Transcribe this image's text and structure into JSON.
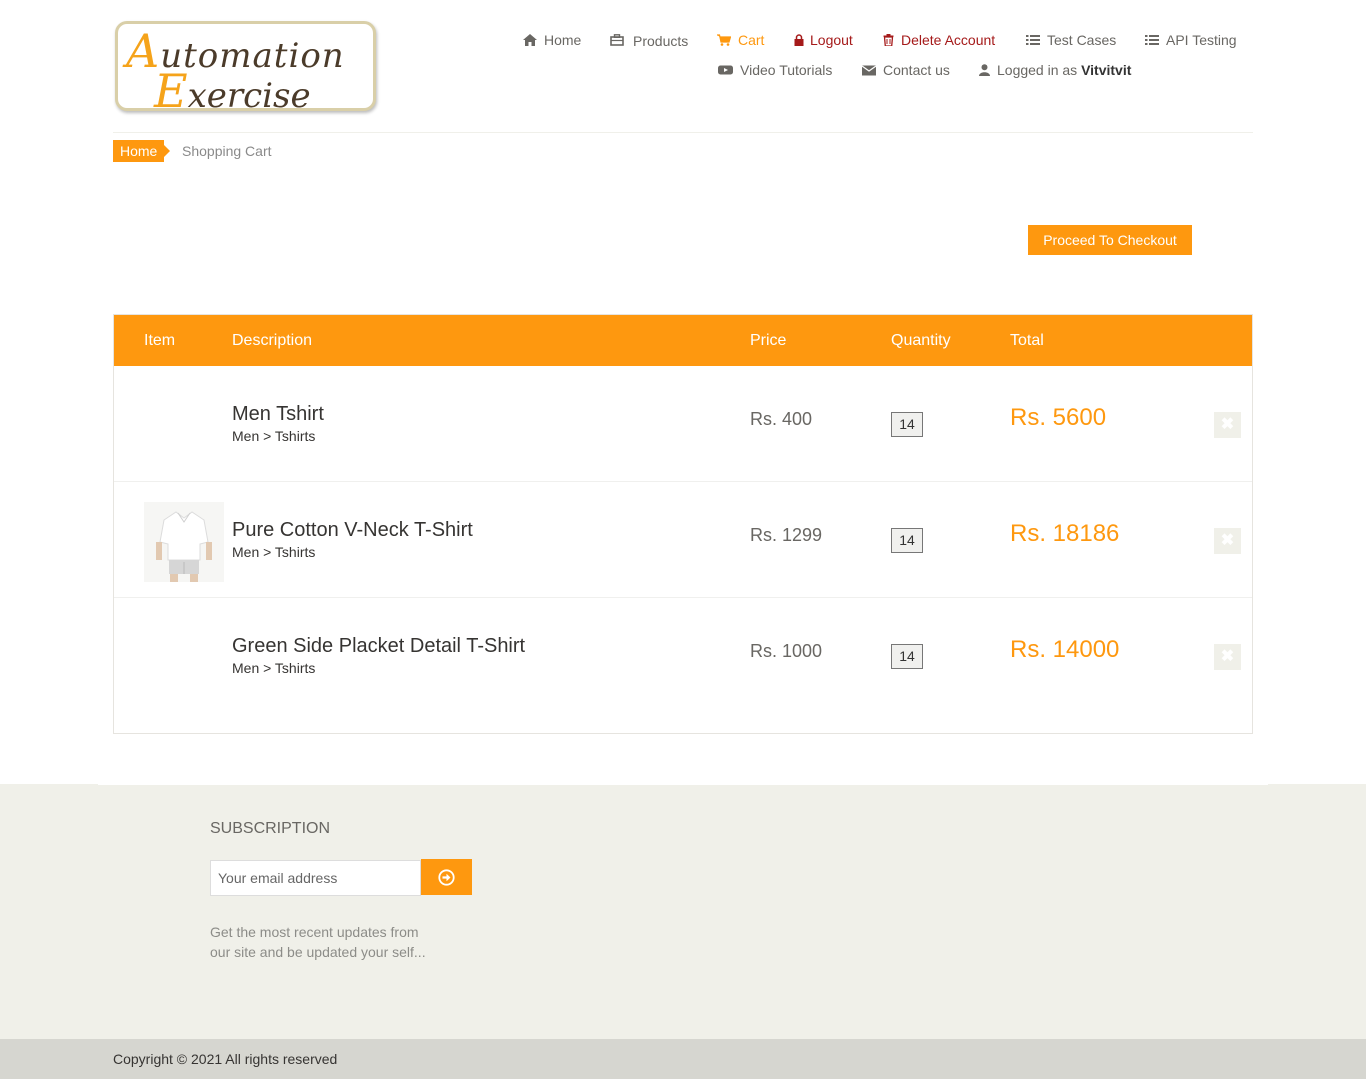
{
  "logo": {
    "line1_big": "A",
    "line1_rest": "utomation",
    "line2_big": "E",
    "line2_rest": "xercise"
  },
  "nav": {
    "home": "Home",
    "products": "Products",
    "cart": "Cart",
    "logout": "Logout",
    "delete_account": "Delete Account",
    "test_cases": "Test Cases",
    "api_testing": "API Testing",
    "video_tutorials": "Video Tutorials",
    "contact_us": "Contact us",
    "logged_in_prefix": "Logged in as",
    "username": "Vitvitvit"
  },
  "breadcrumb": {
    "home": "Home",
    "current": "Shopping Cart"
  },
  "checkout_label": "Proceed To Checkout",
  "table": {
    "headers": {
      "item": "Item",
      "description": "Description",
      "price": "Price",
      "quantity": "Quantity",
      "total": "Total"
    },
    "rows": [
      {
        "name": "Men Tshirt",
        "category": "Men > Tshirts",
        "price": "Rs. 400",
        "quantity": "14",
        "total": "Rs. 5600",
        "has_image": false
      },
      {
        "name": "Pure Cotton V-Neck T-Shirt",
        "category": "Men > Tshirts",
        "price": "Rs. 1299",
        "quantity": "14",
        "total": "Rs. 18186",
        "has_image": true
      },
      {
        "name": "Green Side Placket Detail T-Shirt",
        "category": "Men > Tshirts",
        "price": "Rs. 1000",
        "quantity": "14",
        "total": "Rs. 14000",
        "has_image": false
      }
    ],
    "delete_icon_glyph": "✖"
  },
  "footer": {
    "subscription_title": "SUBSCRIPTION",
    "email_placeholder": "Your email address",
    "note": "Get the most recent updates from our site and be updated your self...",
    "copyright": "Copyright © 2021 All rights reserved"
  },
  "colors": {
    "accent": "#fe980f",
    "danger": "#a51a1a",
    "text": "#696763",
    "footer_bg": "#f0f0e9"
  }
}
